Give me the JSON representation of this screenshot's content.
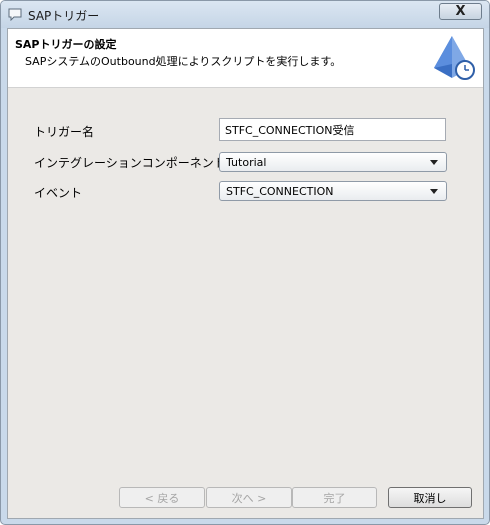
{
  "window": {
    "title": "SAPトリガー",
    "close_label": "X"
  },
  "header": {
    "title": "SAPトリガーの設定",
    "description": "SAPシステムのOutbound処理によりスクリプトを実行します。"
  },
  "form": {
    "trigger_name": {
      "label": "トリガー名",
      "value": "STFC_CONNECTION受信"
    },
    "component": {
      "label": "インテグレーションコンポーネント",
      "value": "Tutorial"
    },
    "event": {
      "label": "イベント",
      "value": "STFC_CONNECTION"
    }
  },
  "buttons": {
    "back": "< 戻る",
    "next": "次へ >",
    "finish": "完了",
    "cancel": "取消し"
  }
}
